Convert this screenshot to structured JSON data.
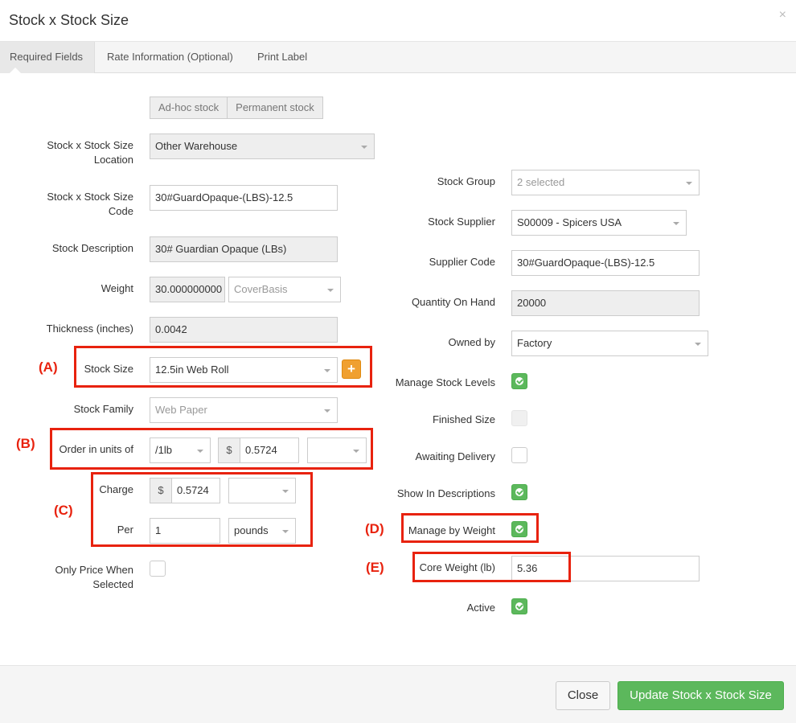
{
  "modal": {
    "title": "Stock x Stock Size",
    "close_glyph": "×"
  },
  "tabs": [
    {
      "label": "Required Fields"
    },
    {
      "label": "Rate Information (Optional)"
    },
    {
      "label": "Print Label"
    }
  ],
  "stock_type": {
    "adhoc": "Ad-hoc stock",
    "permanent": "Permanent stock"
  },
  "left": {
    "location": {
      "label_1": "Stock x Stock Size",
      "label_2": "Location",
      "value": "Other Warehouse"
    },
    "code": {
      "label_1": "Stock x Stock Size",
      "label_2": "Code",
      "value": "30#GuardOpaque-(LBS)-12.5"
    },
    "description": {
      "label": "Stock Description",
      "value": "30# Guardian Opaque (LBs)"
    },
    "weight": {
      "label": "Weight",
      "value": "30.000000000",
      "basis": "CoverBasis"
    },
    "thickness": {
      "label": "Thickness (inches)",
      "value": "0.0042"
    },
    "stock_size": {
      "label": "Stock Size",
      "value": "12.5in Web Roll",
      "add_glyph": "+"
    },
    "stock_family": {
      "label": "Stock Family",
      "value": "Web Paper"
    },
    "order_units": {
      "label": "Order in units of",
      "unit": "/1lb",
      "currency": "$",
      "price": "0.5724",
      "extra": ""
    },
    "charge": {
      "label": "Charge",
      "currency": "$",
      "value": "0.5724",
      "extra": ""
    },
    "per": {
      "label": "Per",
      "value": "1",
      "unit": "pounds"
    },
    "only_price": {
      "label_1": "Only Price When",
      "label_2": "Selected",
      "checked": false
    }
  },
  "right": {
    "stock_group": {
      "label": "Stock Group",
      "value": "2 selected"
    },
    "supplier": {
      "label": "Stock Supplier",
      "value": "S00009 - Spicers USA"
    },
    "supplier_code": {
      "label": "Supplier Code",
      "value": "30#GuardOpaque-(LBS)-12.5"
    },
    "qty_on_hand": {
      "label": "Quantity On Hand",
      "value": "20000"
    },
    "owned_by": {
      "label": "Owned by",
      "value": "Factory"
    },
    "manage_stock_levels": {
      "label": "Manage Stock Levels",
      "checked": true
    },
    "finished_size": {
      "label": "Finished Size",
      "checked": false
    },
    "awaiting_delivery": {
      "label": "Awaiting Delivery",
      "checked": false
    },
    "show_in_descriptions": {
      "label": "Show In Descriptions",
      "checked": true
    },
    "manage_by_weight": {
      "label": "Manage by Weight",
      "checked": true
    },
    "core_weight": {
      "label": "Core Weight (lb)",
      "value": "5.36"
    },
    "active": {
      "label": "Active",
      "checked": true
    }
  },
  "annotations": {
    "a": "(A)",
    "b": "(B)",
    "c": "(C)",
    "d": "(D)",
    "e": "(E)"
  },
  "footer": {
    "close": "Close",
    "update": "Update Stock x Stock Size"
  },
  "colors": {
    "highlight": "#e8220e",
    "success": "#5cb85c",
    "warning": "#f0a030"
  }
}
